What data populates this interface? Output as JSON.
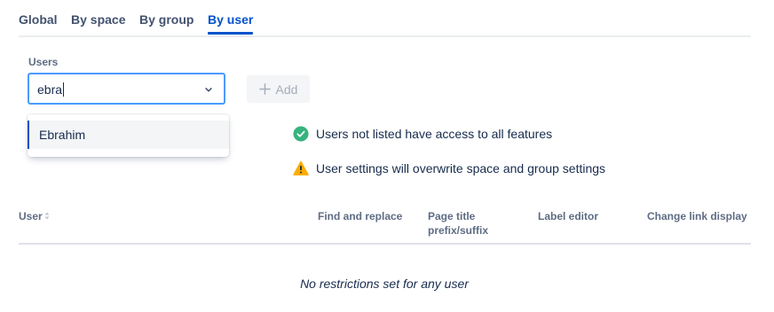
{
  "tabs": [
    {
      "label": "Global",
      "active": false
    },
    {
      "label": "By space",
      "active": false
    },
    {
      "label": "By group",
      "active": false
    },
    {
      "label": "By user",
      "active": true
    }
  ],
  "users_field": {
    "label": "Users",
    "value": "ebra",
    "dropdown_options": [
      "Ebrahim"
    ]
  },
  "add_button": {
    "label": "Add",
    "enabled": false
  },
  "notices": [
    {
      "text": "Users not listed have access to all features",
      "icon": "check-circle-icon",
      "color": "#36b37e"
    },
    {
      "text": "User settings will overwrite space and group settings",
      "icon": "warning-icon",
      "color": "#ffab00"
    }
  ],
  "table": {
    "columns": [
      "User",
      "Find and replace",
      "Page title prefix/suffix",
      "Label editor",
      "Change link display"
    ],
    "empty_message": "No restrictions set for any user"
  },
  "colors": {
    "accent": "#0052cc",
    "focus_border": "#4c9aff"
  }
}
